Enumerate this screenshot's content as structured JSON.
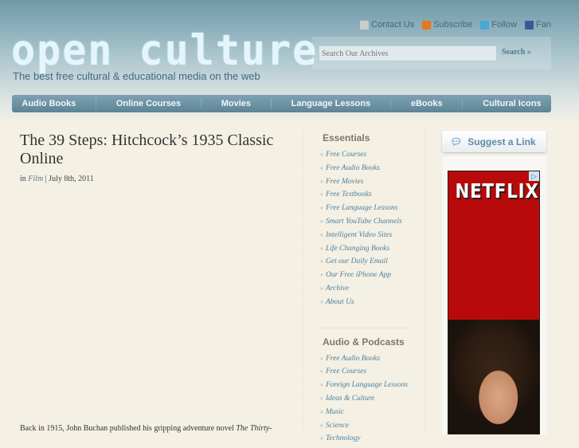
{
  "header": {
    "logo": "open culture",
    "tagline": "The best free cultural & educational media on the web",
    "top_links": [
      {
        "label": "Contact Us",
        "icon": "mail-icon",
        "color": "#cccccc"
      },
      {
        "label": "Subscribe",
        "icon": "rss-icon",
        "color": "#e8771c"
      },
      {
        "label": "Follow",
        "icon": "twitter-icon",
        "color": "#4aa8d8"
      },
      {
        "label": "Fan",
        "icon": "facebook-icon",
        "color": "#3b5998"
      }
    ],
    "search": {
      "placeholder": "Search Our Archives",
      "button": "Search »"
    }
  },
  "nav": [
    "Audio Books",
    "Online Courses",
    "Movies",
    "Language Lessons",
    "eBooks",
    "Cultural Icons"
  ],
  "post": {
    "title": "The 39 Steps: Hitchcock’s 1935 Classic Online",
    "in": "in",
    "category": "Film",
    "date": "| July 8th, 2011",
    "body": "Back in 1915, John Buchan published his gripping adventure novel ",
    "body_em": "The Thirty-"
  },
  "sidebar": {
    "sections": [
      {
        "title": "Essentials",
        "items": [
          "Free Courses",
          "Free Audio Books",
          "Free Movies",
          "Free Textbooks",
          "Free Language Lessons",
          "Smart YouTube Channels",
          "Intelligent Video Sites",
          "Life Changing Books",
          "Get our Daily Email",
          "Our Free iPhone App",
          "Archive",
          "About Us"
        ]
      },
      {
        "title": "Audio & Podcasts",
        "items": [
          "Free Audio Books",
          "Free Courses",
          "Foreign Language Lessons",
          "Ideas & Culture",
          "Music",
          "Science",
          "Technology"
        ]
      }
    ]
  },
  "suggest": "Suggest a Link",
  "ad": {
    "brand": "NETFLIX",
    "color": "#b80a0a"
  }
}
